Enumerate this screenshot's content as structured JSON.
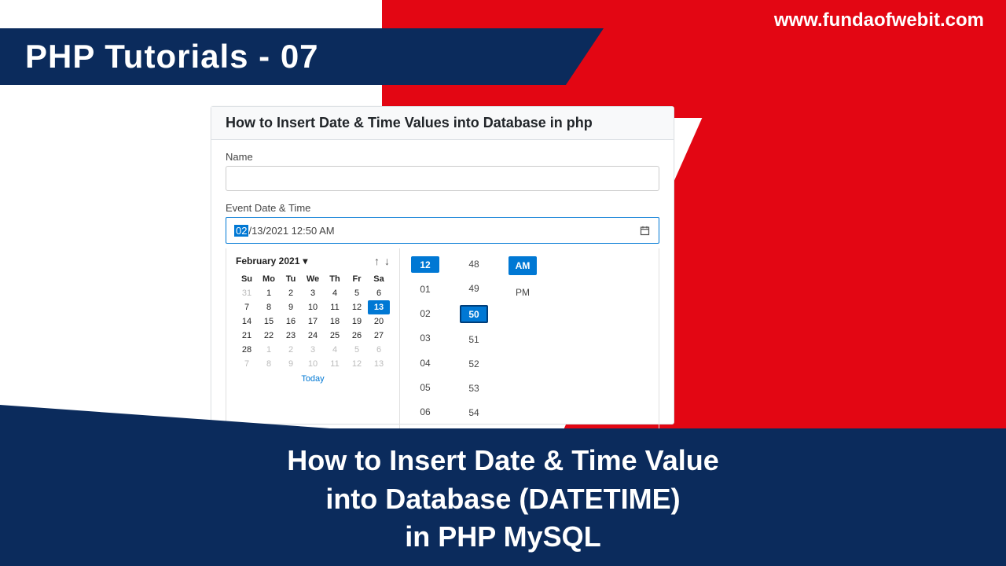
{
  "site_url": "www.fundaofwebit.com",
  "header_title": "PHP Tutorials - 07",
  "card": {
    "title": "How to Insert Date & Time Values into Database in php",
    "name_label": "Name",
    "dt_label": "Event Date & Time",
    "dt_value_sel": "02",
    "dt_value_rest": "/13/2021 12:50 AM"
  },
  "picker": {
    "month": "February 2021",
    "dow": [
      "Su",
      "Mo",
      "Tu",
      "We",
      "Th",
      "Fr",
      "Sa"
    ],
    "grid": [
      [
        {
          "d": "31",
          "dim": true
        },
        {
          "d": "1"
        },
        {
          "d": "2"
        },
        {
          "d": "3"
        },
        {
          "d": "4"
        },
        {
          "d": "5"
        },
        {
          "d": "6"
        }
      ],
      [
        {
          "d": "7"
        },
        {
          "d": "8"
        },
        {
          "d": "9"
        },
        {
          "d": "10"
        },
        {
          "d": "11"
        },
        {
          "d": "12"
        },
        {
          "d": "13",
          "sel": true
        }
      ],
      [
        {
          "d": "14"
        },
        {
          "d": "15"
        },
        {
          "d": "16"
        },
        {
          "d": "17"
        },
        {
          "d": "18"
        },
        {
          "d": "19"
        },
        {
          "d": "20"
        }
      ],
      [
        {
          "d": "21"
        },
        {
          "d": "22"
        },
        {
          "d": "23"
        },
        {
          "d": "24"
        },
        {
          "d": "25"
        },
        {
          "d": "26"
        },
        {
          "d": "27"
        }
      ],
      [
        {
          "d": "28"
        },
        {
          "d": "1",
          "dim": true
        },
        {
          "d": "2",
          "dim": true
        },
        {
          "d": "3",
          "dim": true
        },
        {
          "d": "4",
          "dim": true
        },
        {
          "d": "5",
          "dim": true
        },
        {
          "d": "6",
          "dim": true
        }
      ],
      [
        {
          "d": "7",
          "dim": true
        },
        {
          "d": "8",
          "dim": true
        },
        {
          "d": "9",
          "dim": true
        },
        {
          "d": "10",
          "dim": true
        },
        {
          "d": "11",
          "dim": true
        },
        {
          "d": "12",
          "dim": true
        },
        {
          "d": "13",
          "dim": true
        }
      ]
    ],
    "today": "Today",
    "hours": [
      "12",
      "01",
      "02",
      "03",
      "04",
      "05",
      "06"
    ],
    "hour_sel": "12",
    "minutes": [
      "48",
      "49",
      "50",
      "51",
      "52",
      "53",
      "54"
    ],
    "minute_sel": "50",
    "ampm": [
      "AM",
      "PM"
    ],
    "ampm_sel": "AM"
  },
  "footer": {
    "line1": "How to Insert Date & Time Value",
    "line2": "into Database (DATETIME)",
    "line3": "in PHP MySQL"
  }
}
